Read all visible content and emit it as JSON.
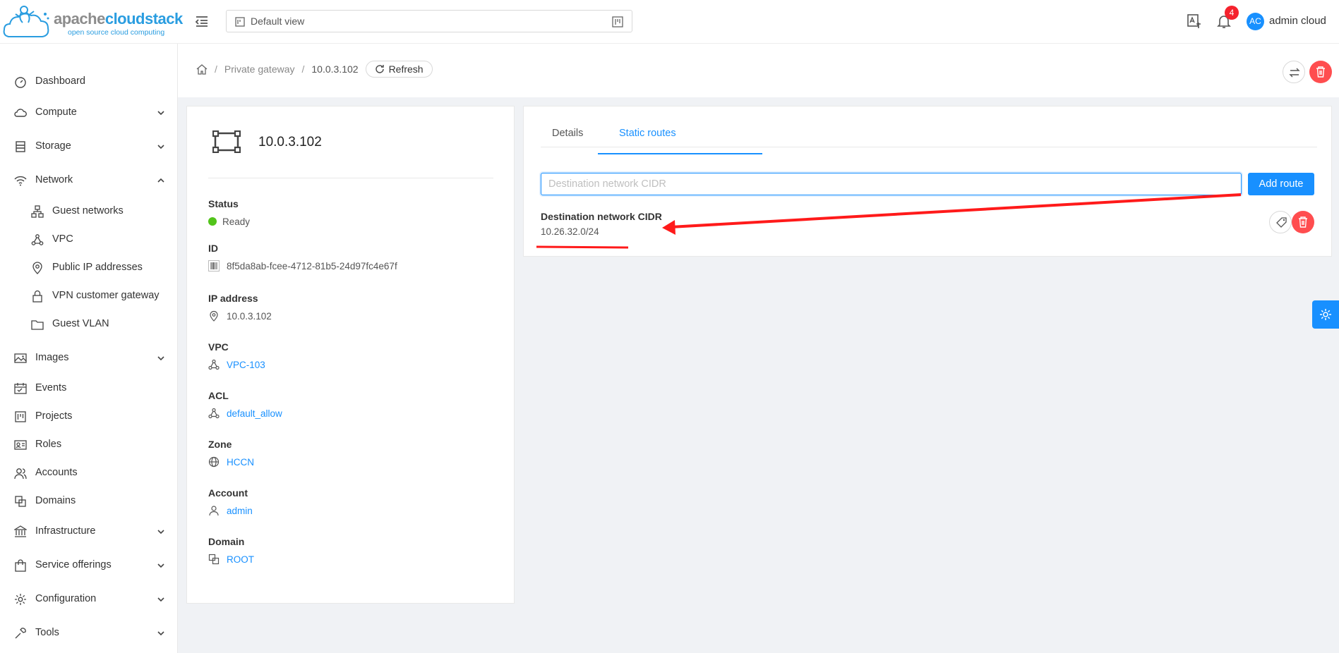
{
  "header": {
    "logo_brand_gray": "apache",
    "logo_brand_blue": "cloudstack",
    "logo_tagline": "open source cloud computing",
    "view_select_value": "Default view",
    "notification_count": "4",
    "avatar_initials": "AC",
    "user_name": "admin cloud"
  },
  "sidebar": {
    "items": [
      {
        "label": "Dashboard",
        "icon": "dashboard-icon"
      },
      {
        "label": "Compute",
        "icon": "cloud-icon",
        "expandable": true
      },
      {
        "label": "Storage",
        "icon": "database-icon",
        "expandable": true
      },
      {
        "label": "Network",
        "icon": "wifi-icon",
        "expanded": true
      },
      {
        "label": "Guest networks",
        "icon": "apartment-icon"
      },
      {
        "label": "VPC",
        "icon": "deployment-unit-icon"
      },
      {
        "label": "Public IP addresses",
        "icon": "environment-icon"
      },
      {
        "label": "VPN customer gateway",
        "icon": "lock-icon"
      },
      {
        "label": "Guest VLAN",
        "icon": "folder-icon"
      },
      {
        "label": "Images",
        "icon": "picture-icon",
        "expandable": true
      },
      {
        "label": "Events",
        "icon": "schedule-icon"
      },
      {
        "label": "Projects",
        "icon": "project-icon"
      },
      {
        "label": "Roles",
        "icon": "idcard-icon"
      },
      {
        "label": "Accounts",
        "icon": "team-icon"
      },
      {
        "label": "Domains",
        "icon": "block-icon"
      },
      {
        "label": "Infrastructure",
        "icon": "bank-icon",
        "expandable": true
      },
      {
        "label": "Service offerings",
        "icon": "shopping-icon",
        "expandable": true
      },
      {
        "label": "Configuration",
        "icon": "setting-icon",
        "expandable": true
      },
      {
        "label": "Tools",
        "icon": "tool-icon",
        "expandable": true
      }
    ]
  },
  "breadcrumb": {
    "items": [
      "Private gateway",
      "10.0.3.102"
    ],
    "refresh_label": "Refresh"
  },
  "resource": {
    "title": "10.0.3.102",
    "fields": {
      "status": {
        "label": "Status",
        "value": "Ready"
      },
      "id": {
        "label": "ID",
        "value": "8f5da8ab-fcee-4712-81b5-24d97fc4e67f"
      },
      "ip": {
        "label": "IP address",
        "value": "10.0.3.102"
      },
      "vpc": {
        "label": "VPC",
        "value": "VPC-103"
      },
      "acl": {
        "label": "ACL",
        "value": "default_allow"
      },
      "zone": {
        "label": "Zone",
        "value": "HCCN"
      },
      "account": {
        "label": "Account",
        "value": "admin"
      },
      "domain": {
        "label": "Domain",
        "value": "ROOT"
      }
    }
  },
  "tabs": {
    "details": "Details",
    "static_routes": "Static routes"
  },
  "static_routes": {
    "input_placeholder": "Destination network CIDR",
    "input_value": "",
    "add_button": "Add route",
    "column_label": "Destination network CIDR",
    "routes": [
      {
        "cidr": "10.26.32.0/24"
      }
    ]
  },
  "colors": {
    "primary": "#1890ff",
    "danger": "#ff4d4f",
    "success": "#52c41a",
    "annotation": "#ff1a1a"
  }
}
